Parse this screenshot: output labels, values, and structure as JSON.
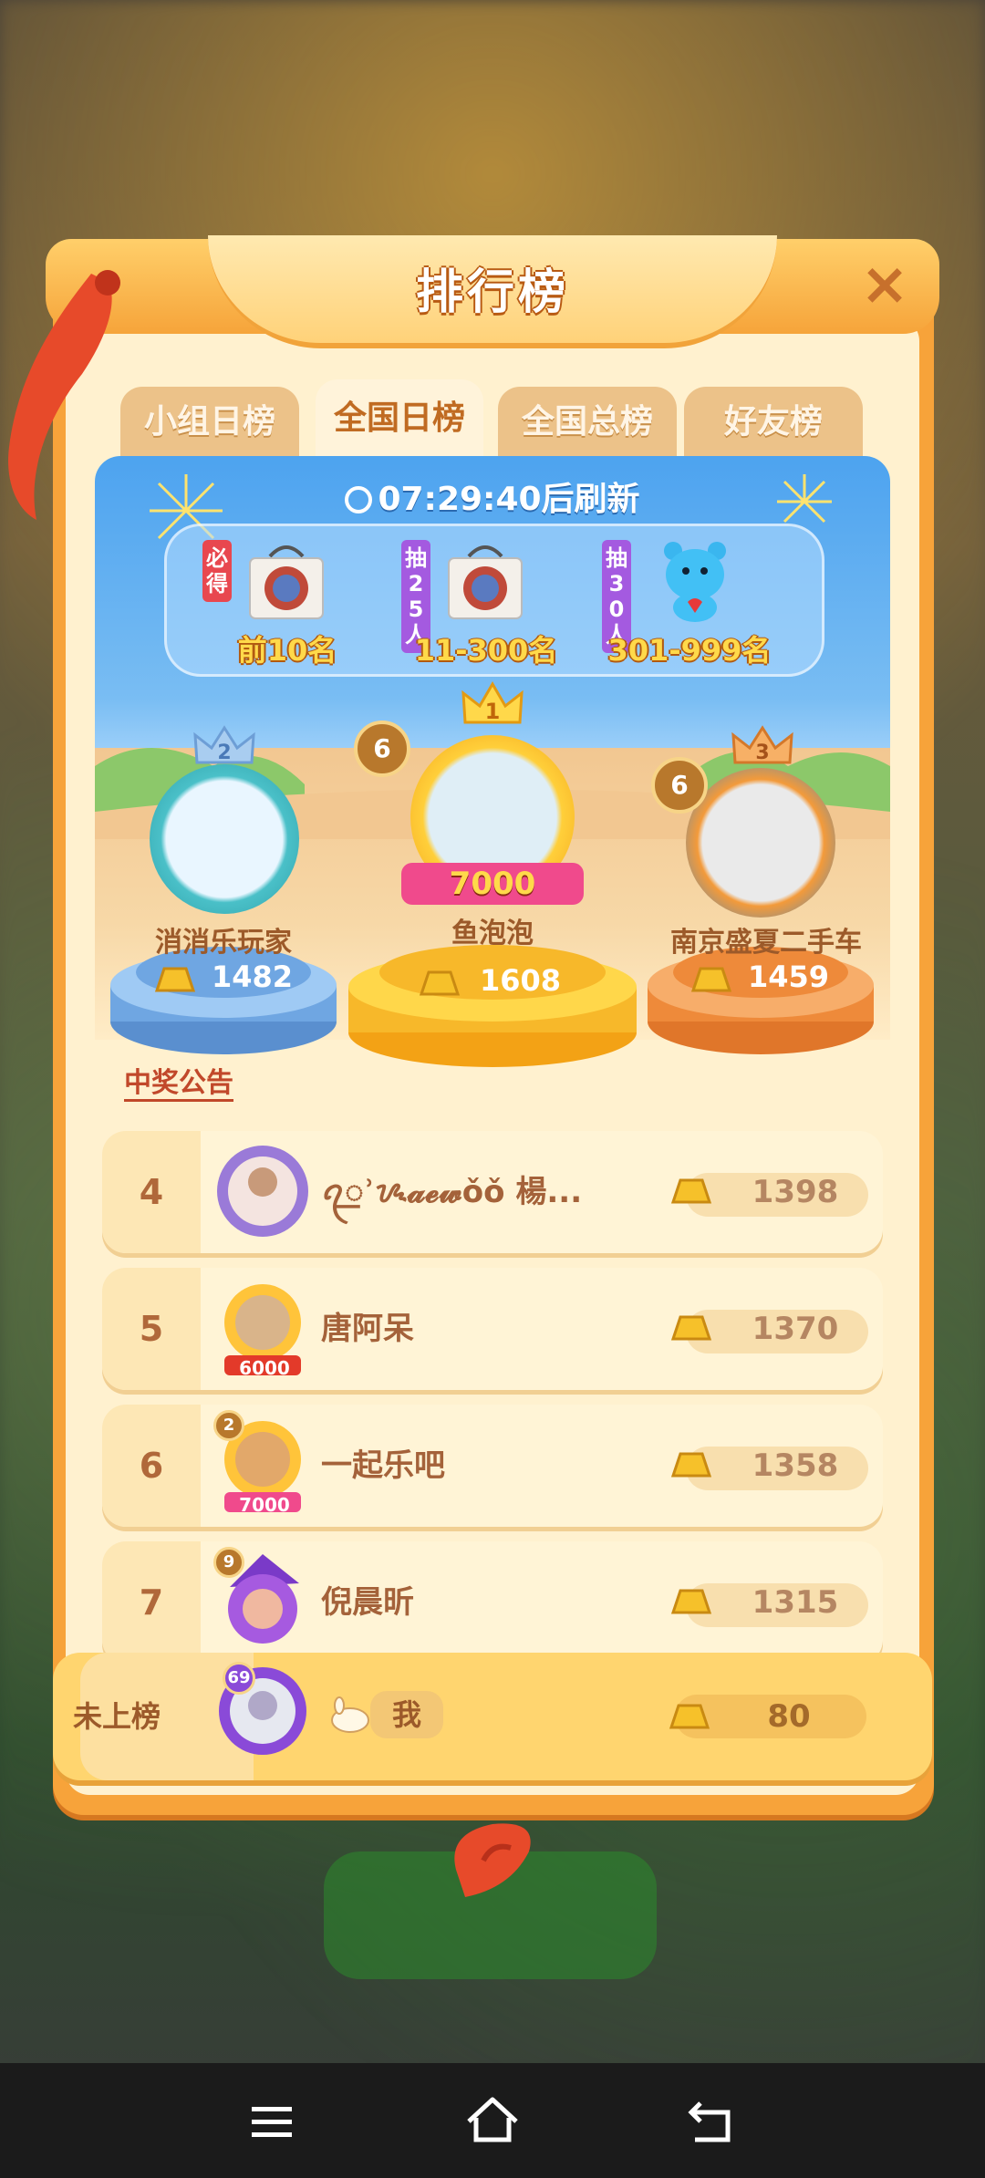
{
  "title": "排行榜",
  "close_label": "×",
  "tabs": [
    "小组日榜",
    "全国日榜",
    "全国总榜",
    "好友榜"
  ],
  "active_tab": "全国日榜",
  "timer": "07:29:40后刷新",
  "prizes": [
    {
      "tag": "必得",
      "label": "前10名"
    },
    {
      "tag": "抽25人",
      "label": "11-300名"
    },
    {
      "tag": "抽30人",
      "label": "301-999名"
    }
  ],
  "podium": [
    {
      "rank": "2",
      "name": "消消乐玩家",
      "score": "1482",
      "level": ""
    },
    {
      "rank": "1",
      "name": "鱼泡泡",
      "score": "1608",
      "level": "6",
      "frame_value": "7000"
    },
    {
      "rank": "3",
      "name": "南京盛夏二手车",
      "score": "1459",
      "level": "6"
    }
  ],
  "announcement": "中奖公告",
  "rows": [
    {
      "rank": "4",
      "name": "ꪖ꯭ʾᝰ𝓪𝓮𝔀ǒǒ 楊...",
      "score": "1398",
      "level": "",
      "frame_value": ""
    },
    {
      "rank": "5",
      "name": "唐阿呆",
      "score": "1370",
      "level": "",
      "frame_value": "6000"
    },
    {
      "rank": "6",
      "name": "一起乐吧",
      "score": "1358",
      "level": "2",
      "frame_value": "7000"
    },
    {
      "rank": "7",
      "name": "倪晨昕",
      "score": "1315",
      "level": "9",
      "frame_value": ""
    }
  ],
  "me": {
    "status": "未上榜",
    "name": "我",
    "score": "80",
    "level": "69"
  },
  "colors": {
    "panel": "#f7a33a",
    "blue": "#4da3ef",
    "cream": "#fff4d6",
    "text_brown": "#a4623a"
  },
  "nav": [
    "menu-icon",
    "home-icon",
    "back-icon"
  ]
}
